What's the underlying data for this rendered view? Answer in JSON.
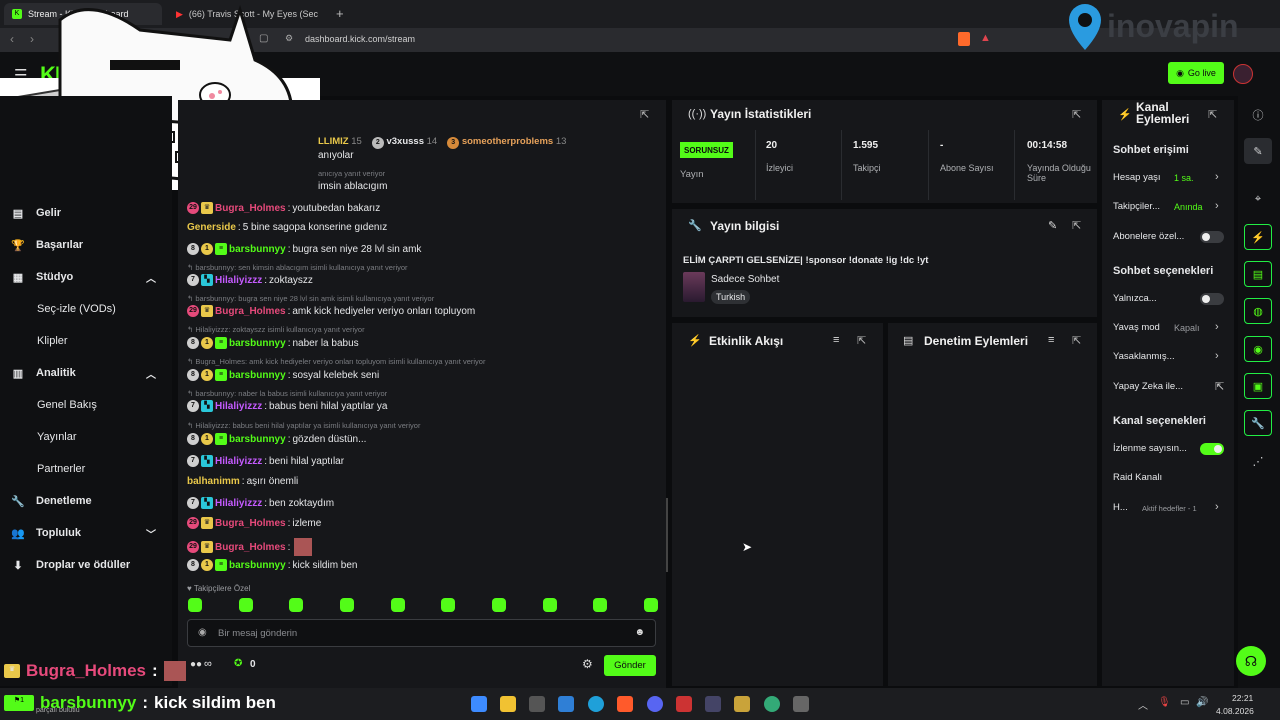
{
  "browser": {
    "tabs": [
      {
        "label": "Stream - Kick Dashboard"
      },
      {
        "label": "(66) Travis Scott - My Eyes (Sec"
      }
    ],
    "url": "dashboard.kick.com/stream"
  },
  "overlay": {
    "brand_text": "inovapin"
  },
  "header": {
    "go_live_label": "Go live",
    "logo_text": "KICK"
  },
  "sidebar": {
    "items": [
      {
        "label": "Gelir",
        "icon": "wallet-icon"
      },
      {
        "label": "Başarılar",
        "icon": "trophy-icon"
      },
      {
        "label": "Stüdyo",
        "icon": "studio-icon"
      },
      {
        "label": "Seç-izle (VODs)"
      },
      {
        "label": "Klipler"
      },
      {
        "label": "Analitik",
        "icon": "chart-icon"
      },
      {
        "label": "Genel Bakış"
      },
      {
        "label": "Yayınlar"
      },
      {
        "label": "Partnerler"
      },
      {
        "label": "Denetleme",
        "icon": "wrench-icon"
      },
      {
        "label": "Topluluk",
        "icon": "people-icon"
      },
      {
        "label": "Droplar ve ödüller",
        "icon": "drops-icon"
      }
    ]
  },
  "chat": {
    "leaderboard": [
      {
        "name": "LLIMIZ",
        "count": "15"
      },
      {
        "name": "v3xusss",
        "count": "14"
      },
      {
        "name": "someotherproblems",
        "count": "13"
      }
    ],
    "partial_top": [
      "anıyolar",
      "anıcıya yanıt veriyor",
      "imsin ablacıgım"
    ],
    "messages": [
      {
        "kind": "msg",
        "badges": [
          "29",
          "crown"
        ],
        "user": "Bugra_Holmes",
        "user_color": "#e64a7b",
        "text": "youtubedan bakarız"
      },
      {
        "kind": "msg",
        "badges": [],
        "user": "Generside",
        "user_color": "#e9c84a",
        "text": "5 bine sagopa konserine gıdenız"
      },
      {
        "kind": "msg",
        "badges": [
          "8",
          "1",
          "sub"
        ],
        "user": "barsbunnyy",
        "user_color": "#53fc18",
        "text": "bugra sen niye 28 lvl sin amk"
      },
      {
        "kind": "reply",
        "text": "barsbunnyy: sen kimsin ablacıgım isimli kullanıcıya yanıt veriyor"
      },
      {
        "kind": "msg",
        "badges": [
          "7",
          "blue"
        ],
        "user": "Hilaliyizzz",
        "user_color": "#c55bff",
        "text": "zoktayszz"
      },
      {
        "kind": "reply",
        "text": "barsbunnyy: bugra sen niye 28 lvl sin amk isimli kullanıcıya yanıt veriyor"
      },
      {
        "kind": "msg",
        "badges": [
          "29",
          "crown"
        ],
        "user": "Bugra_Holmes",
        "user_color": "#e64a7b",
        "text": "amk kick hediyeler veriyo onları topluyom"
      },
      {
        "kind": "reply",
        "text": "Hilaliyizzz: zoktayszz isimli kullanıcıya yanıt veriyor"
      },
      {
        "kind": "msg",
        "badges": [
          "8",
          "1",
          "sub"
        ],
        "user": "barsbunnyy",
        "user_color": "#53fc18",
        "text": "naber la babus"
      },
      {
        "kind": "reply",
        "text": "Bugra_Holmes: amk kick hediyeler veriyo onları topluyom isimli kullanıcıya yanıt veriyor"
      },
      {
        "kind": "msg",
        "badges": [
          "8",
          "1",
          "sub"
        ],
        "user": "barsbunnyy",
        "user_color": "#53fc18",
        "text": "sosyal kelebek seni"
      },
      {
        "kind": "reply",
        "text": "barsbunnyy: naber la babus isimli kullanıcıya yanıt veriyor"
      },
      {
        "kind": "msg",
        "badges": [
          "7",
          "blue"
        ],
        "user": "Hilaliyizzz",
        "user_color": "#c55bff",
        "text": "babus beni hilal yaptılar ya"
      },
      {
        "kind": "reply",
        "text": "Hilaliyizzz: babus beni hilal yaptılar ya isimli kullanıcıya yanıt veriyor"
      },
      {
        "kind": "msg",
        "badges": [
          "8",
          "1",
          "sub"
        ],
        "user": "barsbunnyy",
        "user_color": "#53fc18",
        "text": "gözden düstün..."
      },
      {
        "kind": "msg",
        "badges": [
          "7",
          "blue"
        ],
        "user": "Hilaliyizzz",
        "user_color": "#c55bff",
        "text": "beni hilal yaptılar"
      },
      {
        "kind": "msg",
        "badges": [],
        "user": "balhanimm",
        "user_color": "#e9c84a",
        "text": "aşırı önemli"
      },
      {
        "kind": "msg",
        "badges": [
          "7",
          "blue"
        ],
        "user": "Hilaliyizzz",
        "user_color": "#c55bff",
        "text": "ben zoktaydım"
      },
      {
        "kind": "msg",
        "badges": [
          "29",
          "crown"
        ],
        "user": "Bugra_Holmes",
        "user_color": "#e64a7b",
        "text": "izleme"
      },
      {
        "kind": "msg",
        "badges": [
          "29",
          "crown"
        ],
        "user": "Bugra_Holmes",
        "user_color": "#e64a7b",
        "text": "[emote]"
      },
      {
        "kind": "msg",
        "badges": [
          "8",
          "1",
          "sub"
        ],
        "user": "barsbunnyy",
        "user_color": "#53fc18",
        "text": "kick sildim ben"
      }
    ],
    "followers_only_label": "Takipçilere Özel",
    "input_placeholder": "Bir mesaj gönderin",
    "points_label": "∞",
    "points_count": "0",
    "send_label": "Gönder"
  },
  "stats": {
    "title": "Yayın İstatistikleri",
    "status_badge": "SORUNSUZ",
    "status_label": "Yayın",
    "items": [
      {
        "value": "20",
        "label": "İzleyici"
      },
      {
        "value": "1.595",
        "label": "Takipçi"
      },
      {
        "value": "-",
        "label": "Abone Sayısı"
      },
      {
        "value": "00:14:58",
        "label": "Yayında Olduğu Süre"
      }
    ]
  },
  "info": {
    "title": "Yayın bilgisi",
    "stream_title": "ELİM ÇARPTI GELSENİZE| !sponsor !donate !ig !dc !yt",
    "category": "Sadece Sohbet",
    "language": "Turkish"
  },
  "activity": {
    "title": "Etkinlik Akışı"
  },
  "moderation": {
    "title": "Denetim Eylemleri"
  },
  "channel_actions": {
    "title": "Kanal Eylemleri",
    "chat_access_title": "Sohbet erişimi",
    "chat_access": [
      {
        "label": "Hesap yaşı",
        "value": "1 sa.",
        "value_color": "#53fc18"
      },
      {
        "label": "Takipçiler...",
        "value": "Anında",
        "value_color": "#53fc18"
      },
      {
        "label": "Abonelere özel...",
        "toggle": "off"
      }
    ],
    "chat_options_title": "Sohbet seçenekleri",
    "chat_options": [
      {
        "label": "Yalnızca...",
        "toggle": "off"
      },
      {
        "label": "Yavaş mod",
        "value": "Kapalı",
        "value_color": "#9a9ca0"
      },
      {
        "label": "Yasaklanmış..."
      },
      {
        "label": "Yapay Zeka ile..."
      }
    ],
    "channel_options_title": "Kanal seçenekleri",
    "channel_options": [
      {
        "label": "İzlenme sayısın...",
        "toggle": "on"
      },
      {
        "label": "Raid Kanalı"
      },
      {
        "label": "H...",
        "value": "Aktif hedefler - 1",
        "value_color": "#9a9ca0"
      }
    ]
  },
  "stream_overlay": {
    "line1_user": "Bugra_Holmes",
    "line2_user": "barsbunnyy",
    "line2_text": "kick sildim ben",
    "line2_sub": "parçalı bulutlu"
  },
  "taskbar": {
    "time": "22:21",
    "date": "4.08.2026"
  }
}
